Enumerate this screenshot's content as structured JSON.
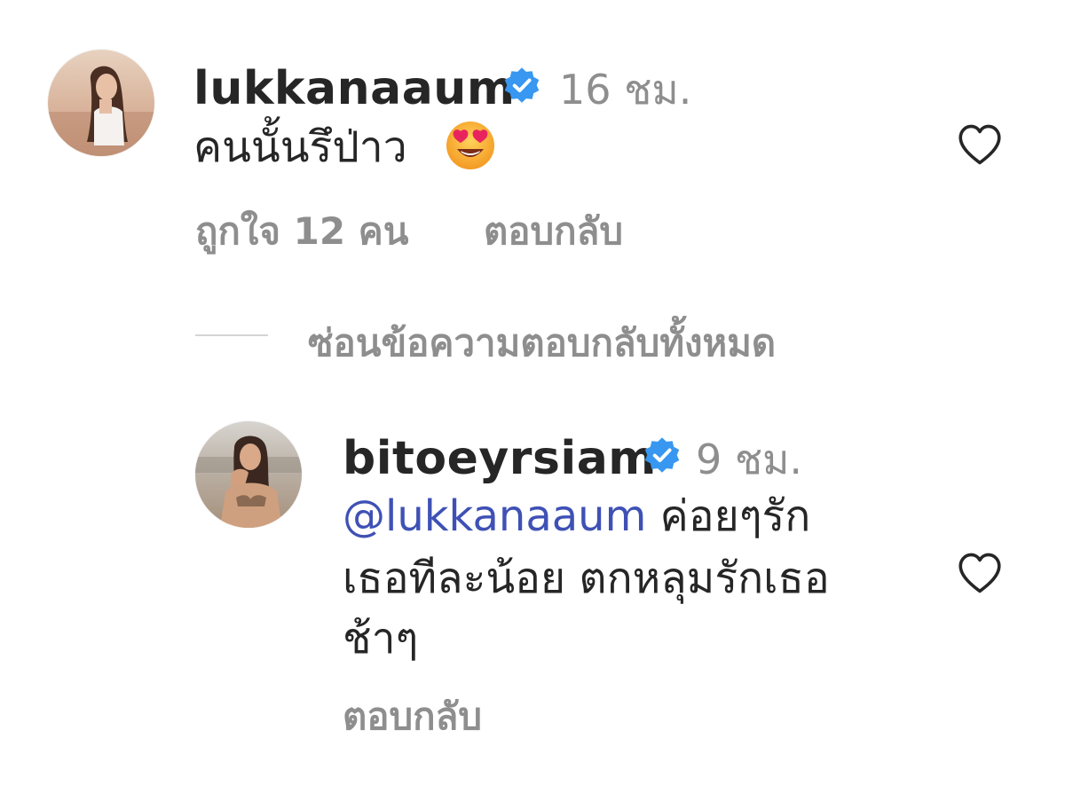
{
  "colors": {
    "text_primary": "#262626",
    "text_secondary": "#8e8e8e",
    "mention": "#3f51b5",
    "verified": "#3897f0"
  },
  "comment": {
    "username": "lukkanaaum",
    "time": "16 ชม.",
    "text": "คนนั้นรึป่าว",
    "emoji_icon": "heart-eyes-emoji-icon",
    "likes": "ถูกใจ 12 คน",
    "reply_label": "ตอบกลับ"
  },
  "replies_toggle": {
    "label": "ซ่อนข้อความตอบกลับทั้งหมด"
  },
  "reply": {
    "username": "bitoeyrsiam",
    "time": "9 ชม.",
    "mention": "@lukkanaaum",
    "text_line1_rest": "ค่อยๆรัก",
    "text_line2": "เธอทีละน้อย ตกหลุมรักเธอ",
    "text_line3": "ช้าๆ",
    "reply_label": "ตอบกลับ"
  }
}
